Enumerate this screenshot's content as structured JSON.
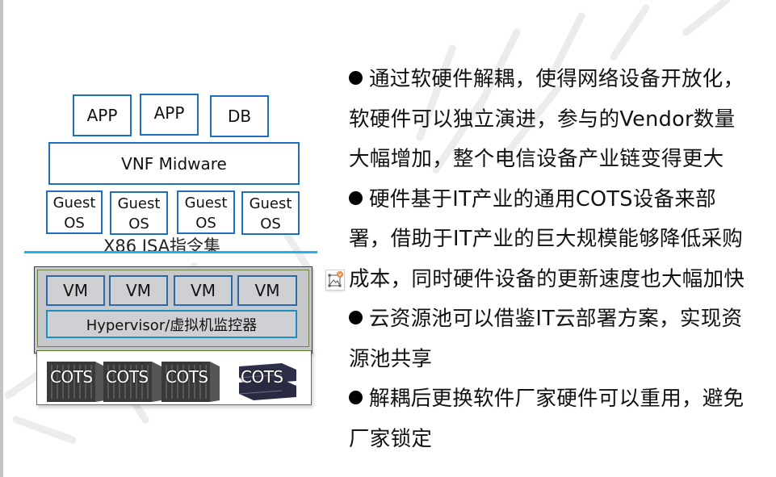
{
  "diagram": {
    "app_layer": [
      {
        "label": "APP"
      },
      {
        "label": "APP"
      },
      {
        "label": "DB"
      }
    ],
    "middleware": {
      "label": "VNF Midware"
    },
    "guest_os": [
      {
        "line1": "Guest",
        "line2": "OS"
      },
      {
        "line1": "Guest",
        "line2": "OS"
      },
      {
        "line1": "Guest",
        "line2": "OS"
      },
      {
        "line1": "Guest",
        "line2": "OS"
      }
    ],
    "isa": {
      "label": "X86 ISA指令集"
    },
    "vms": [
      {
        "label": "VM"
      },
      {
        "label": "VM"
      },
      {
        "label": "VM"
      },
      {
        "label": "VM"
      }
    ],
    "hypervisor": {
      "label": "Hypervisor/虚拟机监控器"
    },
    "hardware": [
      {
        "label": "COTS",
        "kind": "blade-chassis"
      },
      {
        "label": "COTS",
        "kind": "blade-chassis"
      },
      {
        "label": "COTS",
        "kind": "blade-chassis"
      },
      {
        "label": "COTS",
        "kind": "rack-server"
      }
    ],
    "colors": {
      "box_border": "#1f6fc0",
      "isa_line": "#22b2e8",
      "virt_bg": "#c7c8cc",
      "frame_green": "#5b7a2e"
    }
  },
  "bullets": [
    {
      "lines": [
        "通过软硬件解耦，使得网络设备开放化，",
        "软硬件可以独立演进，参与的Vendor数量",
        "大幅增加，整个电信设备产业链变得更大"
      ]
    },
    {
      "lines": [
        "硬件基于IT产业的通用COTS设备来部",
        "署，借助于IT产业的巨大规模能够降低采购",
        "成本，同时硬件设备的更新速度也大幅加快"
      ]
    },
    {
      "lines": [
        "云资源池可以借鉴IT云部署方案，实现资",
        "源池共享"
      ]
    },
    {
      "lines": [
        "解耦后更换软件厂家硬件可以重用，避免",
        "厂家锁定"
      ]
    }
  ],
  "icons": {
    "image_placeholder": "image-placeholder-icon"
  }
}
